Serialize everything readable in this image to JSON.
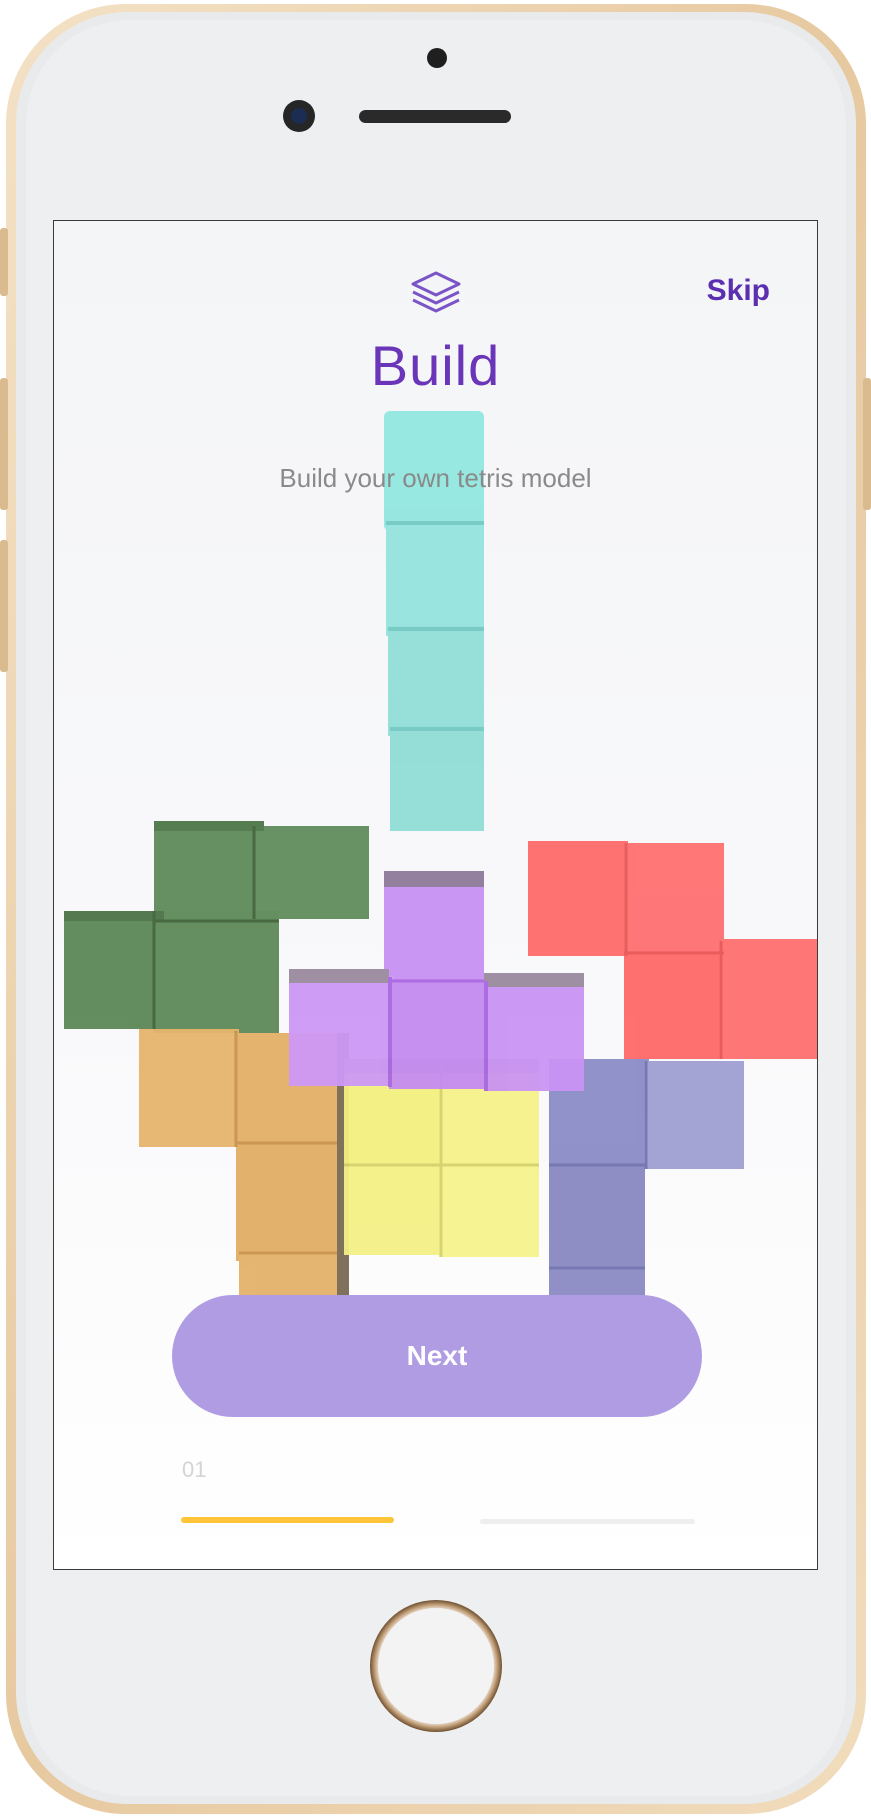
{
  "header": {
    "skip_label": "Skip",
    "logo_icon": "layers-icon"
  },
  "main": {
    "title": "Build",
    "subtitle": "Build your own tetris model",
    "next_label": "Next"
  },
  "pagination": {
    "current": "01"
  },
  "colors": {
    "accent": "#6a35b8",
    "button": "#b09ce3",
    "progress": "#ffc53a",
    "cyan": "#8fe5df",
    "green": "#5f8a5a",
    "purple": "#c08ef2",
    "red": "#ff6b6b",
    "orange": "#e3b36b",
    "yellow": "#f6f38a",
    "indigo": "#8e8fc7"
  }
}
